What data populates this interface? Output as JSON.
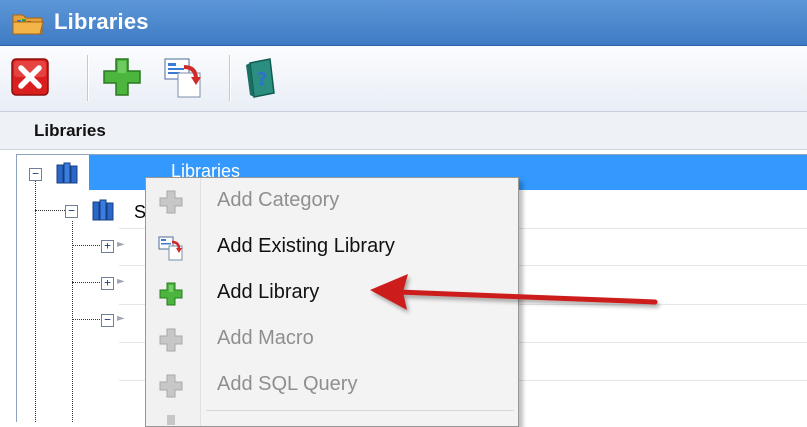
{
  "window": {
    "title": "Libraries",
    "icon": "folder-books-icon"
  },
  "toolbar": {
    "buttons": [
      {
        "name": "close-button",
        "icon": "red-x-icon"
      },
      {
        "name": "add-button",
        "icon": "green-plus-icon"
      },
      {
        "name": "add-existing-button",
        "icon": "import-icon"
      },
      {
        "name": "help-button",
        "icon": "help-book-icon"
      }
    ]
  },
  "section": {
    "header": "Libraries"
  },
  "tree": {
    "root": {
      "label": "Libraries",
      "selected": true
    },
    "child_partial_label": "S"
  },
  "context_menu": {
    "items": [
      {
        "label": "Add Category",
        "enabled": false,
        "icon": "plus-gray-icon"
      },
      {
        "label": "Add Existing Library",
        "enabled": true,
        "icon": "import-icon"
      },
      {
        "label": "Add Library",
        "enabled": true,
        "icon": "plus-green-icon"
      },
      {
        "label": "Add Macro",
        "enabled": false,
        "icon": "plus-gray-icon"
      },
      {
        "label": "Add SQL Query",
        "enabled": false,
        "icon": "plus-gray-icon"
      }
    ]
  },
  "colors": {
    "titlebar": "#4a86cf",
    "selection": "#3399ff",
    "arrow": "#cc1f1f"
  }
}
